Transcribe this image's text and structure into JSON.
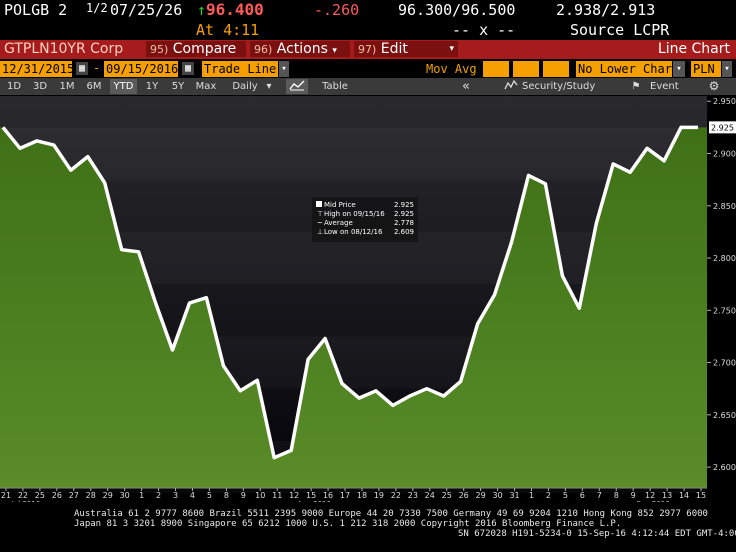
{
  "header": {
    "ticker": "POLGB 2",
    "coupon_fraction": "1/2",
    "maturity": "07/25/26",
    "up_arrow": "↑",
    "last_price": "96.400",
    "change": "-.260",
    "bid_ask": "96.300/96.500",
    "yields": "2.938/2.913",
    "at_time": "At 4:11",
    "x_sep": "-- x --",
    "source": "Source LCPR"
  },
  "commandbar": {
    "security": "GTPLN10YR Corp",
    "compare_num": "95)",
    "compare": "Compare",
    "actions_num": "96)",
    "actions": "Actions",
    "edit_num": "97)",
    "edit": "Edit",
    "chart_type": "Line Chart"
  },
  "datebar": {
    "start_date": "12/31/2015",
    "dash": "-",
    "end_date": "09/15/2016",
    "line_type": "Trade Line",
    "mov_avg": "Mov Avg",
    "lower_chart": "No Lower Chart",
    "currency": "PLN"
  },
  "toolbar": {
    "periods": [
      "1D",
      "3D",
      "1M",
      "6M",
      "YTD",
      "1Y",
      "5Y",
      "Max"
    ],
    "selected_period": "YTD",
    "frequency": "Daily",
    "table": "Table",
    "security_study": "Security/Study",
    "event": "Event"
  },
  "legend": {
    "mid_price_label": "Mid Price",
    "mid_price_value": "2.925",
    "high_label": "High on 09/15/16",
    "high_value": "2.925",
    "average_label": "Average",
    "average_value": "2.778",
    "low_label": "Low on 08/12/16",
    "low_value": "2.609"
  },
  "chart_data": {
    "type": "area",
    "ylim": [
      2.58,
      2.955
    ],
    "y_ticks": [
      "2.950",
      "2.900",
      "2.850",
      "2.800",
      "2.750",
      "2.700",
      "2.650",
      "2.600"
    ],
    "last_value_label": "2.925",
    "x_ticks": [
      "21",
      "22",
      "25",
      "26",
      "27",
      "28",
      "29",
      "30",
      "1",
      "2",
      "3",
      "4",
      "5",
      "8",
      "9",
      "10",
      "11",
      "12",
      "15",
      "16",
      "17",
      "18",
      "19",
      "22",
      "23",
      "24",
      "25",
      "26",
      "29",
      "30",
      "31",
      "1",
      "2",
      "5",
      "6",
      "7",
      "8",
      "9",
      "12",
      "13",
      "14",
      "15"
    ],
    "month_labels": [
      "Jul 2016",
      "Aug 2016",
      "Sep 2016"
    ],
    "values": [
      2.925,
      2.905,
      2.912,
      2.908,
      2.884,
      2.897,
      2.872,
      2.808,
      2.806,
      2.757,
      2.712,
      2.757,
      2.762,
      2.697,
      2.673,
      2.683,
      2.609,
      2.616,
      2.703,
      2.723,
      2.68,
      2.666,
      2.673,
      2.659,
      2.668,
      2.675,
      2.668,
      2.682,
      2.737,
      2.765,
      2.815,
      2.879,
      2.871,
      2.783,
      2.752,
      2.833,
      2.89,
      2.882,
      2.905,
      2.893,
      2.925,
      2.925
    ],
    "colors": {
      "area_top": "#4a7a1e",
      "area_bottom": "#3a6a14",
      "line": "#ffffff",
      "bg": "#0a0a10"
    }
  },
  "footer": {
    "line1": "Australia 61 2 9777 8600 Brazil 5511 2395 9000 Europe 44 20 7330 7500 Germany 49 69 9204 1210 Hong Kong 852 2977 6000",
    "line2": "Japan 81 3 3201 8900      Singapore 65 6212 1000      U.S. 1 212 318 2000               Copyright 2016 Bloomberg Finance L.P.",
    "line3": "SN 672028 H191-5234-0 15-Sep-16  4:12:44 EDT  GMT-4:00"
  }
}
